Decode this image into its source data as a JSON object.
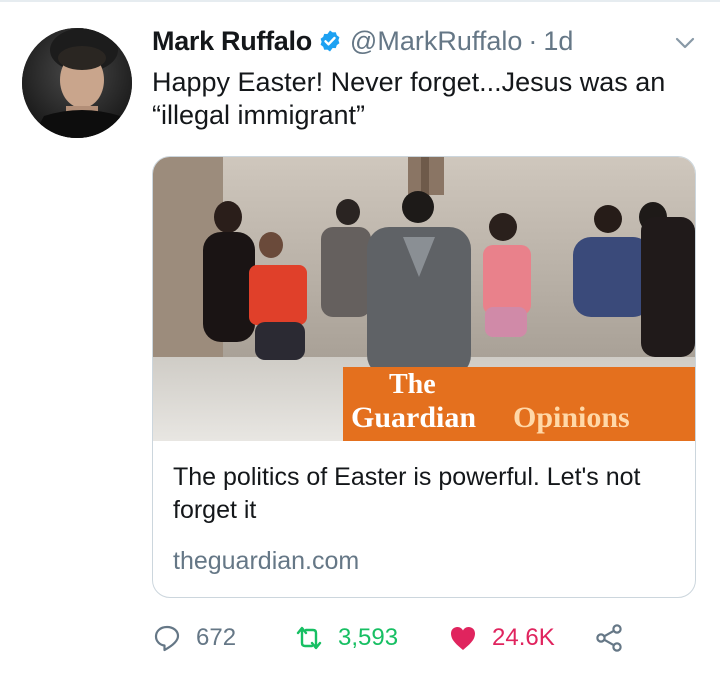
{
  "tweet": {
    "author_name": "Mark Ruffalo",
    "handle": "@MarkRuffalo",
    "separator": "·",
    "time": "1d",
    "text": "Happy Easter! Never forget...Jesus was an “illegal immigrant”"
  },
  "card": {
    "image_brand_line1": "The",
    "image_brand_line2": "Guardian",
    "image_brand_section": "Opinions",
    "title": "The politics of Easter is powerful. Let's not forget it",
    "domain": "theguardian.com"
  },
  "actions": {
    "replies": "672",
    "retweets": "3,593",
    "likes": "24.6K"
  },
  "colors": {
    "verified": "#1da1f2",
    "retweet": "#17bf63",
    "like": "#e0245e",
    "secondary_text": "#657786",
    "guardian_orange": "#e4701e"
  },
  "icons": [
    "verified-badge-icon",
    "chevron-down-icon",
    "reply-icon",
    "retweet-icon",
    "heart-icon",
    "share-icon"
  ]
}
